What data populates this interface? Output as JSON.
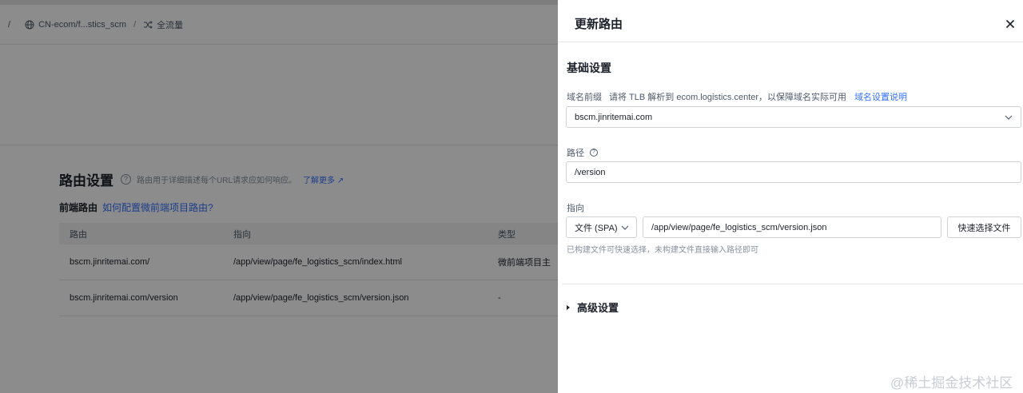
{
  "breadcrumb": {
    "sep": "/",
    "domain": "CN-ecom/f...stics_scm",
    "traffic": "全流量"
  },
  "routes": {
    "title": "路由设置",
    "help_icon": "question-circle-icon",
    "description": "路由用于详细描述每个URL请求应如何响应。",
    "learn_more": "了解更多",
    "frontend_title": "前端路由",
    "frontend_link": "如何配置微前端项目路由?",
    "columns": [
      "路由",
      "指向",
      "类型"
    ],
    "rows": [
      {
        "route": "bscm.jinritemai.com/",
        "target": "/app/view/page/fe_logistics_scm/index.html",
        "type": "微前端项目主"
      },
      {
        "route": "bscm.jinritemai.com/version",
        "target": "/app/view/page/fe_logistics_scm/version.json",
        "type": "-"
      }
    ]
  },
  "drawer": {
    "title": "更新路由",
    "section_basic": "基础设置",
    "domain_label": "域名前缀",
    "domain_hint": "请将 TLB 解析到 ecom.logistics.center，以保障域名实际可用",
    "domain_help_link": "域名设置说明",
    "domain_value": "bscm.jinritemai.com",
    "path_label": "路径",
    "path_value": "/version",
    "target_label": "指向",
    "target_type": "文件 (SPA)",
    "target_path": "/app/view/page/fe_logistics_scm/version.json",
    "quick_select": "快速选择文件",
    "target_help": "已构建文件可快速选择，未构建文件直接输入路径即可",
    "section_advanced": "高级设置"
  },
  "watermark": "@稀土掘金技术社区",
  "colors": {
    "accent": "#3370ff",
    "mask": "rgba(0,0,0,0.45)"
  }
}
